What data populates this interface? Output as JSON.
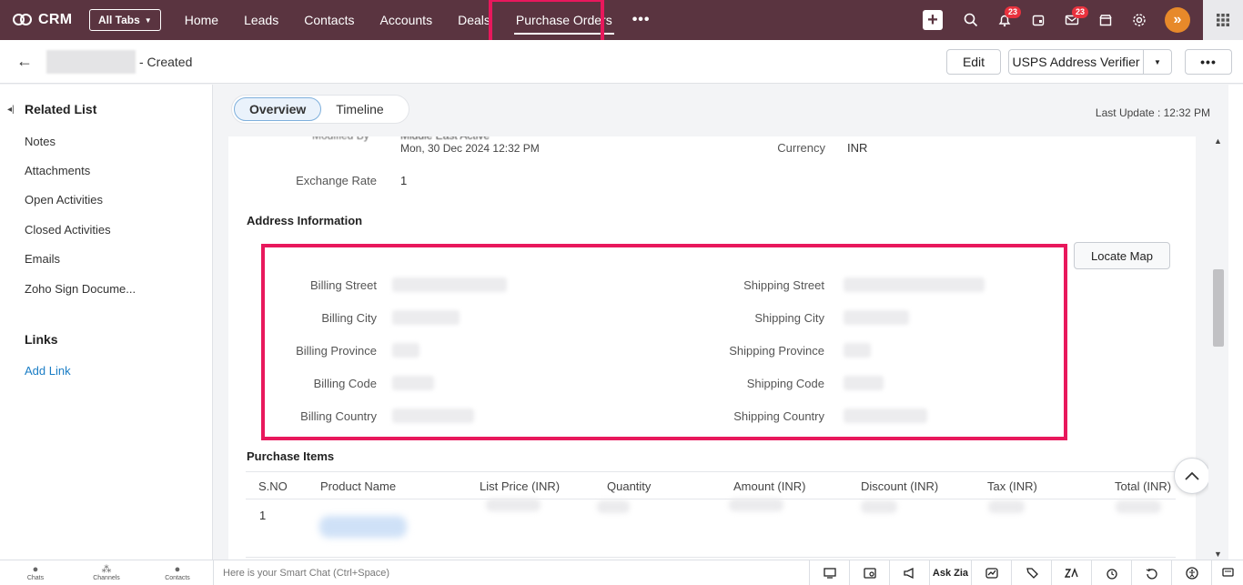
{
  "topbar": {
    "brand": "CRM",
    "all_tabs": "All Tabs",
    "tabs": [
      "Home",
      "Leads",
      "Contacts",
      "Accounts",
      "Deals",
      "Purchase Orders"
    ],
    "active_tab": "Purchase Orders",
    "notification_count": "23",
    "mail_count": "23",
    "avatar_glyph": "»"
  },
  "record": {
    "status": "- Created",
    "edit_label": "Edit",
    "usps_label": "USPS Address Verifier",
    "more_label": "•••"
  },
  "sidebar": {
    "related_title": "Related List",
    "related_items": [
      "Notes",
      "Attachments",
      "Open Activities",
      "Closed Activities",
      "Emails",
      "Zoho Sign Docume..."
    ],
    "links_title": "Links",
    "add_link": "Add Link"
  },
  "main": {
    "tabs": [
      "Overview",
      "Timeline"
    ],
    "last_update": "Last Update : 12:32 PM",
    "modified_date": "Mon, 30 Dec 2024 12:32 PM",
    "currency_label": "Currency",
    "currency_value": "INR",
    "exchange_label": "Exchange Rate",
    "exchange_value": "1",
    "address_title": "Address Information",
    "billing_labels": [
      "Billing Street",
      "Billing City",
      "Billing Province",
      "Billing Code",
      "Billing Country"
    ],
    "shipping_labels": [
      "Shipping Street",
      "Shipping City",
      "Shipping Province",
      "Shipping Code",
      "Shipping Country"
    ],
    "locate_map": "Locate Map",
    "items_title": "Purchase Items",
    "item_columns": [
      "S.NO",
      "Product Name",
      "List Price (INR)",
      "Quantity",
      "Amount (INR)",
      "Discount (INR)",
      "Tax (INR)",
      "Total (INR)"
    ],
    "row_sno": "1"
  },
  "bottombar": {
    "left_items": [
      "Chats",
      "Channels",
      "Contacts"
    ],
    "smartchat_placeholder": "Here is your Smart Chat (Ctrl+Space)",
    "ask_zia": "Ask Zia"
  }
}
